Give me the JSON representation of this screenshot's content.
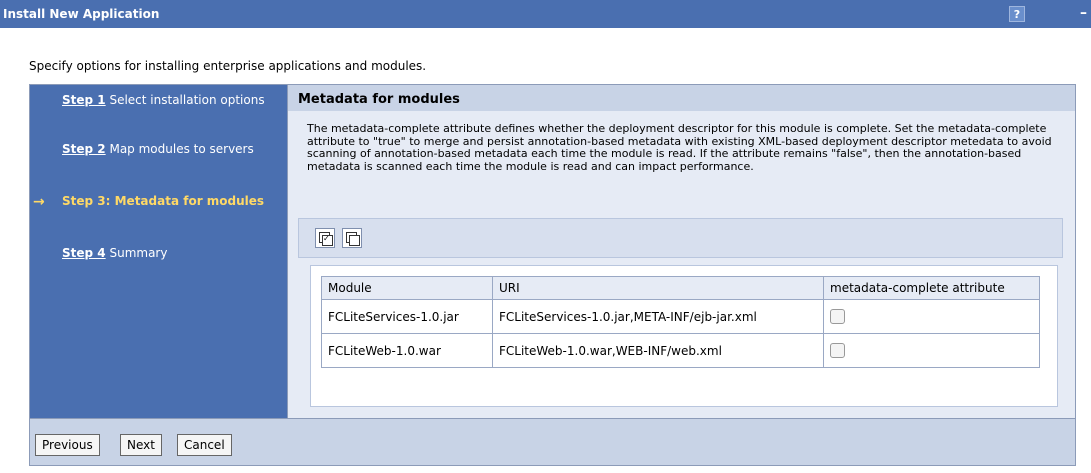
{
  "window": {
    "title": "Install New Application",
    "help_label": "?",
    "minimize_label": "–"
  },
  "intro_text": "Specify options for installing enterprise applications and modules.",
  "steps": [
    {
      "num": "Step 1",
      "label": "Select installation options",
      "current": false
    },
    {
      "num": "Step 2",
      "label": "Map modules to servers",
      "current": false
    },
    {
      "num": "Step 3: Metadata for modules",
      "label": "",
      "current": true
    },
    {
      "num": "Step 4",
      "label": "Summary",
      "current": false
    }
  ],
  "current_arrow": "→",
  "panel": {
    "title": "Metadata for modules",
    "description": "The metadata-complete attribute defines whether the deployment descriptor for this module is complete. Set the metadata-complete attribute to \"true\" to merge and persist annotation-based metadata with existing XML-based deployment descriptor metedata to avoid scanning of annotation-based metadata each time the module is read. If the attribute remains \"false\", then the annotation-based metadata is scanned each time the module is read and can impact performance.",
    "toolbar": [
      {
        "icon": "select-all-icon"
      },
      {
        "icon": "deselect-all-icon"
      }
    ]
  },
  "table": {
    "headers": [
      "Module",
      "URI",
      "metadata-complete attribute"
    ],
    "rows": [
      {
        "module": "FCLiteServices-1.0.jar",
        "uri": "FCLiteServices-1.0.jar,META-INF/ejb-jar.xml",
        "checked": false
      },
      {
        "module": "FCLiteWeb-1.0.war",
        "uri": "FCLiteWeb-1.0.war,WEB-INF/web.xml",
        "checked": false
      }
    ]
  },
  "buttons": {
    "previous": "Previous",
    "next": "Next",
    "cancel": "Cancel"
  },
  "colors": {
    "title_bar": "#4a6fb0",
    "current_step": "#ffd966",
    "panel_header": "#c8d3e6"
  }
}
